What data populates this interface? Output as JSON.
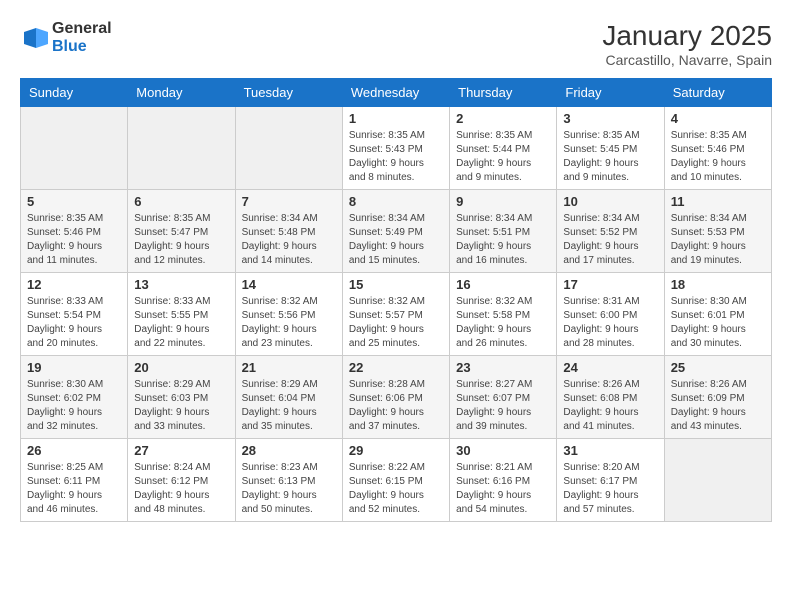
{
  "logo": {
    "general": "General",
    "blue": "Blue"
  },
  "title": "January 2025",
  "subtitle": "Carcastillo, Navarre, Spain",
  "weekdays": [
    "Sunday",
    "Monday",
    "Tuesday",
    "Wednesday",
    "Thursday",
    "Friday",
    "Saturday"
  ],
  "weeks": [
    [
      {
        "day": "",
        "sunrise": "",
        "sunset": "",
        "daylight": ""
      },
      {
        "day": "",
        "sunrise": "",
        "sunset": "",
        "daylight": ""
      },
      {
        "day": "",
        "sunrise": "",
        "sunset": "",
        "daylight": ""
      },
      {
        "day": "1",
        "sunrise": "Sunrise: 8:35 AM",
        "sunset": "Sunset: 5:43 PM",
        "daylight": "Daylight: 9 hours and 8 minutes."
      },
      {
        "day": "2",
        "sunrise": "Sunrise: 8:35 AM",
        "sunset": "Sunset: 5:44 PM",
        "daylight": "Daylight: 9 hours and 9 minutes."
      },
      {
        "day": "3",
        "sunrise": "Sunrise: 8:35 AM",
        "sunset": "Sunset: 5:45 PM",
        "daylight": "Daylight: 9 hours and 9 minutes."
      },
      {
        "day": "4",
        "sunrise": "Sunrise: 8:35 AM",
        "sunset": "Sunset: 5:46 PM",
        "daylight": "Daylight: 9 hours and 10 minutes."
      }
    ],
    [
      {
        "day": "5",
        "sunrise": "Sunrise: 8:35 AM",
        "sunset": "Sunset: 5:46 PM",
        "daylight": "Daylight: 9 hours and 11 minutes."
      },
      {
        "day": "6",
        "sunrise": "Sunrise: 8:35 AM",
        "sunset": "Sunset: 5:47 PM",
        "daylight": "Daylight: 9 hours and 12 minutes."
      },
      {
        "day": "7",
        "sunrise": "Sunrise: 8:34 AM",
        "sunset": "Sunset: 5:48 PM",
        "daylight": "Daylight: 9 hours and 14 minutes."
      },
      {
        "day": "8",
        "sunrise": "Sunrise: 8:34 AM",
        "sunset": "Sunset: 5:49 PM",
        "daylight": "Daylight: 9 hours and 15 minutes."
      },
      {
        "day": "9",
        "sunrise": "Sunrise: 8:34 AM",
        "sunset": "Sunset: 5:51 PM",
        "daylight": "Daylight: 9 hours and 16 minutes."
      },
      {
        "day": "10",
        "sunrise": "Sunrise: 8:34 AM",
        "sunset": "Sunset: 5:52 PM",
        "daylight": "Daylight: 9 hours and 17 minutes."
      },
      {
        "day": "11",
        "sunrise": "Sunrise: 8:34 AM",
        "sunset": "Sunset: 5:53 PM",
        "daylight": "Daylight: 9 hours and 19 minutes."
      }
    ],
    [
      {
        "day": "12",
        "sunrise": "Sunrise: 8:33 AM",
        "sunset": "Sunset: 5:54 PM",
        "daylight": "Daylight: 9 hours and 20 minutes."
      },
      {
        "day": "13",
        "sunrise": "Sunrise: 8:33 AM",
        "sunset": "Sunset: 5:55 PM",
        "daylight": "Daylight: 9 hours and 22 minutes."
      },
      {
        "day": "14",
        "sunrise": "Sunrise: 8:32 AM",
        "sunset": "Sunset: 5:56 PM",
        "daylight": "Daylight: 9 hours and 23 minutes."
      },
      {
        "day": "15",
        "sunrise": "Sunrise: 8:32 AM",
        "sunset": "Sunset: 5:57 PM",
        "daylight": "Daylight: 9 hours and 25 minutes."
      },
      {
        "day": "16",
        "sunrise": "Sunrise: 8:32 AM",
        "sunset": "Sunset: 5:58 PM",
        "daylight": "Daylight: 9 hours and 26 minutes."
      },
      {
        "day": "17",
        "sunrise": "Sunrise: 8:31 AM",
        "sunset": "Sunset: 6:00 PM",
        "daylight": "Daylight: 9 hours and 28 minutes."
      },
      {
        "day": "18",
        "sunrise": "Sunrise: 8:30 AM",
        "sunset": "Sunset: 6:01 PM",
        "daylight": "Daylight: 9 hours and 30 minutes."
      }
    ],
    [
      {
        "day": "19",
        "sunrise": "Sunrise: 8:30 AM",
        "sunset": "Sunset: 6:02 PM",
        "daylight": "Daylight: 9 hours and 32 minutes."
      },
      {
        "day": "20",
        "sunrise": "Sunrise: 8:29 AM",
        "sunset": "Sunset: 6:03 PM",
        "daylight": "Daylight: 9 hours and 33 minutes."
      },
      {
        "day": "21",
        "sunrise": "Sunrise: 8:29 AM",
        "sunset": "Sunset: 6:04 PM",
        "daylight": "Daylight: 9 hours and 35 minutes."
      },
      {
        "day": "22",
        "sunrise": "Sunrise: 8:28 AM",
        "sunset": "Sunset: 6:06 PM",
        "daylight": "Daylight: 9 hours and 37 minutes."
      },
      {
        "day": "23",
        "sunrise": "Sunrise: 8:27 AM",
        "sunset": "Sunset: 6:07 PM",
        "daylight": "Daylight: 9 hours and 39 minutes."
      },
      {
        "day": "24",
        "sunrise": "Sunrise: 8:26 AM",
        "sunset": "Sunset: 6:08 PM",
        "daylight": "Daylight: 9 hours and 41 minutes."
      },
      {
        "day": "25",
        "sunrise": "Sunrise: 8:26 AM",
        "sunset": "Sunset: 6:09 PM",
        "daylight": "Daylight: 9 hours and 43 minutes."
      }
    ],
    [
      {
        "day": "26",
        "sunrise": "Sunrise: 8:25 AM",
        "sunset": "Sunset: 6:11 PM",
        "daylight": "Daylight: 9 hours and 46 minutes."
      },
      {
        "day": "27",
        "sunrise": "Sunrise: 8:24 AM",
        "sunset": "Sunset: 6:12 PM",
        "daylight": "Daylight: 9 hours and 48 minutes."
      },
      {
        "day": "28",
        "sunrise": "Sunrise: 8:23 AM",
        "sunset": "Sunset: 6:13 PM",
        "daylight": "Daylight: 9 hours and 50 minutes."
      },
      {
        "day": "29",
        "sunrise": "Sunrise: 8:22 AM",
        "sunset": "Sunset: 6:15 PM",
        "daylight": "Daylight: 9 hours and 52 minutes."
      },
      {
        "day": "30",
        "sunrise": "Sunrise: 8:21 AM",
        "sunset": "Sunset: 6:16 PM",
        "daylight": "Daylight: 9 hours and 54 minutes."
      },
      {
        "day": "31",
        "sunrise": "Sunrise: 8:20 AM",
        "sunset": "Sunset: 6:17 PM",
        "daylight": "Daylight: 9 hours and 57 minutes."
      },
      {
        "day": "",
        "sunrise": "",
        "sunset": "",
        "daylight": ""
      }
    ]
  ]
}
